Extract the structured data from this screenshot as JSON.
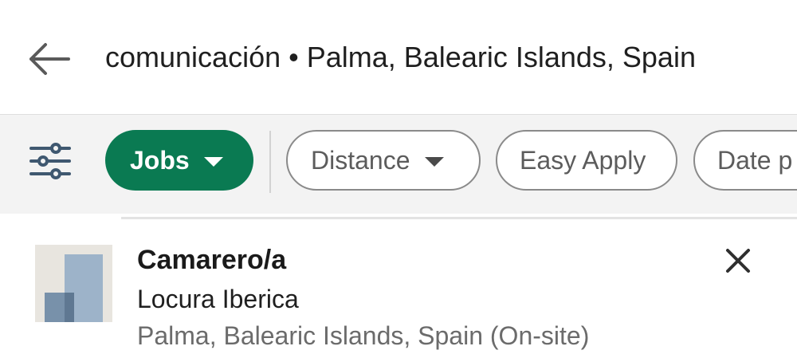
{
  "search": {
    "query": "comunicación • Palma, Balearic Islands, Spain",
    "back_icon": "arrow-left-icon"
  },
  "filters": {
    "settings_icon": "sliders-icon",
    "pills": [
      {
        "label": "Jobs",
        "selected": true,
        "has_dropdown": true
      },
      {
        "label": "Distance",
        "selected": false,
        "has_dropdown": true
      },
      {
        "label": "Easy Apply",
        "selected": false,
        "has_dropdown": false
      },
      {
        "label": "Date p",
        "selected": false,
        "has_dropdown": false
      }
    ]
  },
  "job": {
    "title": "Camarero/a",
    "company": "Locura Iberica",
    "location": "Palma, Balearic Islands, Spain (On-site)",
    "dismiss_icon": "close-icon",
    "logo_icon": "company-logo"
  },
  "colors": {
    "accent_green": "#0a7a52",
    "text_primary": "#1f1f1f",
    "text_secondary": "#6b6b6b",
    "filter_bar_bg": "#f3f3f3",
    "pill_border": "#8a8a8a",
    "logo_light": "#9db3c9",
    "logo_dark": "#5f7892"
  }
}
